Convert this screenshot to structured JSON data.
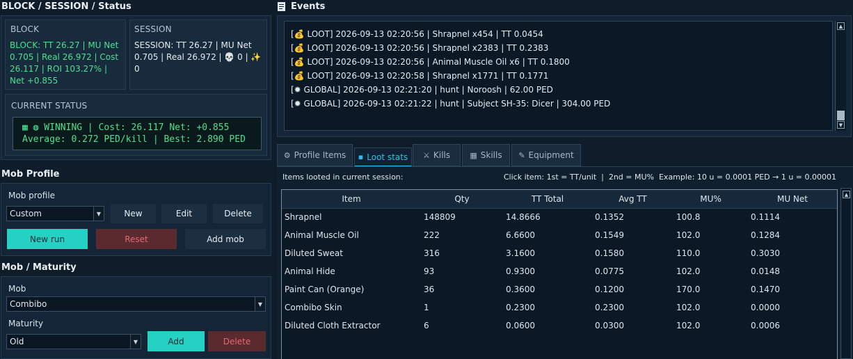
{
  "block_session": {
    "title": "BLOCK / SESSION / Status",
    "block": {
      "heading": "BLOCK",
      "text": "BLOCK: TT 26.27 | MU Net 0.705 | Real 26.972 | Cost 26.117 | ROI 103.27% | Net +0.855"
    },
    "session": {
      "heading": "SESSION",
      "text": "SESSION: TT 26.27 | MU Net 0.705 | Real 26.972 | 💀 0 | ✨ 0"
    },
    "current_status": {
      "heading": "CURRENT STATUS",
      "line1": "▦ ◍ WINNING | Cost: 26.117 Net: +0.855",
      "line2": "Average: 0.272 PED/kill | Best: 2.890 PED"
    }
  },
  "mob_profile": {
    "title": "Mob Profile",
    "label": "Mob profile",
    "selected": "Custom",
    "buttons": {
      "new": "New",
      "edit": "Edit",
      "delete": "Delete",
      "new_run": "New run",
      "reset": "Reset",
      "add_mob": "Add mob"
    }
  },
  "mob_maturity": {
    "title": "Mob / Maturity",
    "mob_label": "Mob",
    "mob_selected": "Combibo",
    "maturity_label": "Maturity",
    "maturity_selected": "Old",
    "buttons": {
      "add": "Add",
      "delete": "Delete"
    }
  },
  "events": {
    "title": "Events",
    "lines": [
      "[💰 LOOT] 2026-09-13 02:20:56 | Shrapnel x454 | TT 0.0454",
      "[💰 LOOT] 2026-09-13 02:20:56 | Shrapnel x2383 | TT 0.2383",
      "[💰 LOOT] 2026-09-13 02:20:56 | Animal Muscle Oil x6 | TT 0.1800",
      "[💰 LOOT] 2026-09-13 02:20:58 | Shrapnel x1771 | TT 0.1771",
      "[✹ GLOBAL] 2026-09-13 02:21:20 | hunt | Noroosh | 62.00 PED",
      "[✹ GLOBAL] 2026-09-13 02:21:22 | hunt | Subject SH-35: Dicer | 304.00 PED"
    ]
  },
  "tabs": [
    {
      "label": "Profile Items",
      "icon": "⚙"
    },
    {
      "label": "Loot stats",
      "icon": "▪"
    },
    {
      "label": "Kills",
      "icon": "⚔"
    },
    {
      "label": "Skills",
      "icon": "▦"
    },
    {
      "label": "Equipment",
      "icon": "✎"
    }
  ],
  "loot_stats": {
    "caption": "Items looted in current session:",
    "hint": "Click item: 1st = TT/unit  |  2nd = MU%  Example: 10 u = 0.0001 PED → 1 u = 0.00001",
    "columns": [
      "Item",
      "Qty",
      "TT Total",
      "Avg TT",
      "MU%",
      "MU Net"
    ],
    "rows": [
      [
        "Shrapnel",
        "148809",
        "14.8666",
        "0.1352",
        "100.8",
        "0.1114"
      ],
      [
        "Animal Muscle Oil",
        "222",
        "6.6600",
        "0.1549",
        "102.0",
        "0.1284"
      ],
      [
        "Diluted Sweat",
        "316",
        "3.1600",
        "0.1580",
        "110.0",
        "0.3030"
      ],
      [
        "Animal Hide",
        "93",
        "0.9300",
        "0.0775",
        "102.0",
        "0.0148"
      ],
      [
        "Paint Can (Orange)",
        "36",
        "0.3600",
        "0.1200",
        "170.0",
        "0.1470"
      ],
      [
        "Combibo Skin",
        "1",
        "0.2300",
        "0.2300",
        "102.0",
        "0.0000"
      ],
      [
        "Diluted Cloth Extractor",
        "6",
        "0.0600",
        "0.0300",
        "102.0",
        "0.0006"
      ]
    ]
  },
  "colors": {
    "background": "#0f1d2b",
    "accent_green": "#4fe08e",
    "accent_cyan": "#26d1c4",
    "danger": "#e36b71"
  }
}
